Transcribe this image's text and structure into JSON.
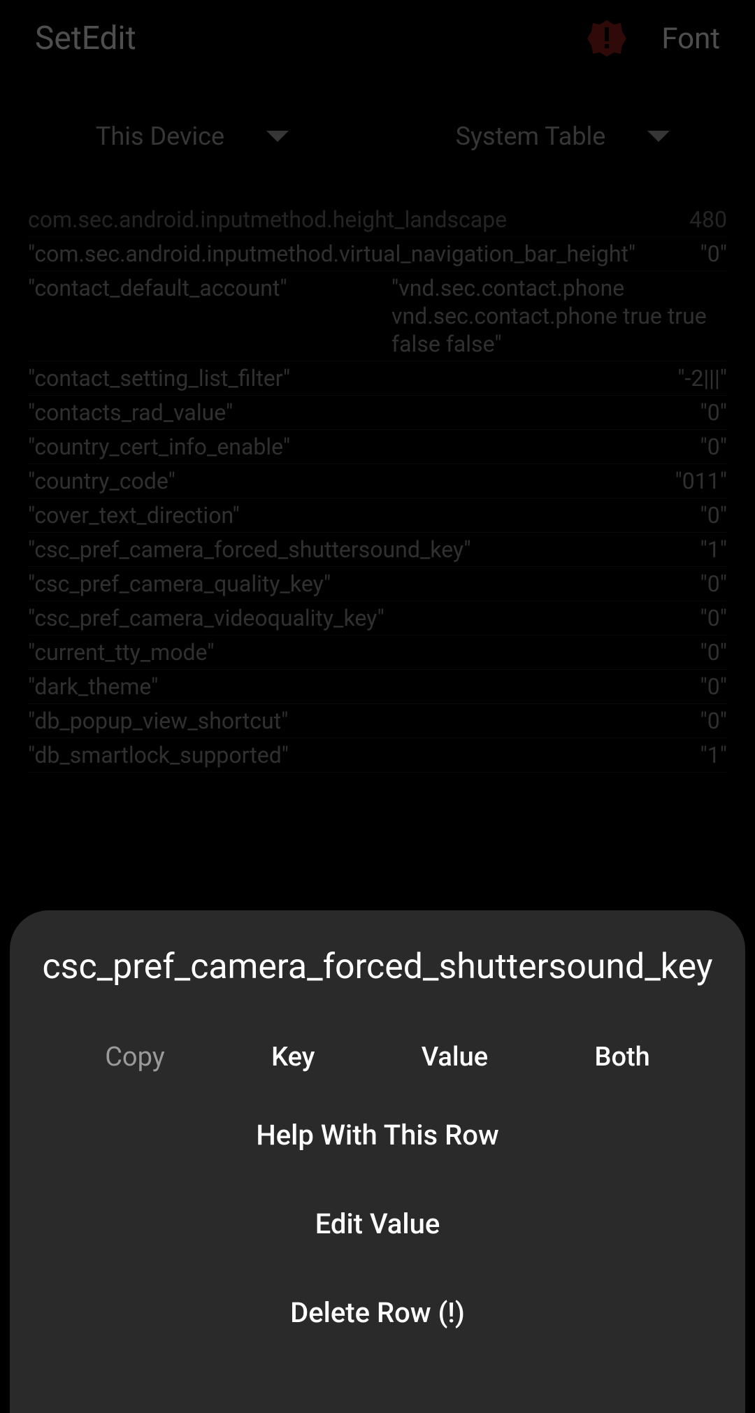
{
  "header": {
    "title": "SetEdit",
    "font_label": "Font"
  },
  "dropdowns": {
    "device_label": "This Device",
    "table_label": "System Table"
  },
  "rows": [
    {
      "key": "com.sec.android.inputmethod.height_landscape",
      "value": "480",
      "partial": true
    },
    {
      "key": "\"com.sec.android.inputmethod.virtual_navigation_bar_height\"",
      "value": "\"0\""
    },
    {
      "key": "\"contact_default_account\"",
      "value": "\"vnd.sec.contact.phone vnd.sec.contact.phone  true true false false\""
    },
    {
      "key": "\"contact_setting_list_filter\"",
      "value": "\"-2|||\""
    },
    {
      "key": "\"contacts_rad_value\"",
      "value": "\"0\""
    },
    {
      "key": "\"country_cert_info_enable\"",
      "value": "\"0\""
    },
    {
      "key": "\"country_code\"",
      "value": "\"011\""
    },
    {
      "key": "\"cover_text_direction\"",
      "value": "\"0\""
    },
    {
      "key": "\"csc_pref_camera_forced_shuttersound_key\"",
      "value": "\"1\""
    },
    {
      "key": "\"csc_pref_camera_quality_key\"",
      "value": "\"0\""
    },
    {
      "key": "\"csc_pref_camera_videoquality_key\"",
      "value": "\"0\""
    },
    {
      "key": "\"current_tty_mode\"",
      "value": "\"0\""
    },
    {
      "key": "\"dark_theme\"",
      "value": "\"0\""
    },
    {
      "key": "\"db_popup_view_shortcut\"",
      "value": "\"0\""
    },
    {
      "key": "\"db_smartlock_supported\"",
      "value": "\"1\""
    }
  ],
  "dialog": {
    "title": "csc_pref_camera_forced_shuttersound_key",
    "copy_label": "Copy",
    "copy_key": "Key",
    "copy_value": "Value",
    "copy_both": "Both",
    "help_label": "Help With This Row",
    "edit_label": "Edit Value",
    "delete_label": "Delete Row (!)"
  }
}
